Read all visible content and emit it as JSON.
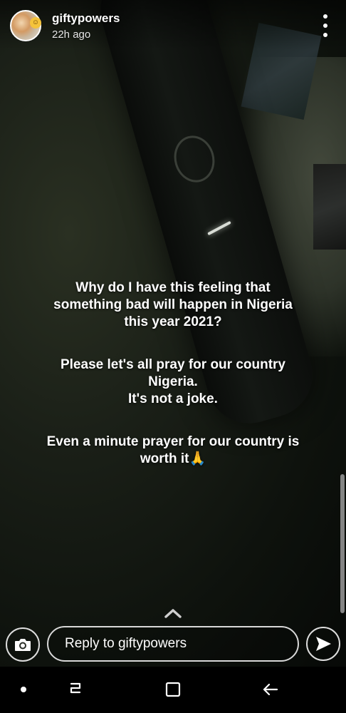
{
  "story": {
    "username": "giftypowers",
    "timestamp": "22h ago",
    "avatar_badge_icon": "smiley-face",
    "caption": {
      "line1": "Why do I have this feeling that",
      "line2": "something bad will happen in Nigeria",
      "line3": "this year 2021?",
      "line4": "Please let's all pray for our country",
      "line5": "Nigeria.",
      "line6": "It's not a joke.",
      "line7": "Even a minute prayer for our country is",
      "line8": "worth it",
      "emoji": "🙏"
    }
  },
  "reply": {
    "placeholder": "Reply to giftypowers",
    "camera_icon": "camera-icon",
    "send_icon": "send-icon"
  },
  "navbar": {
    "items": [
      "nav-dot",
      "recent-apps",
      "home",
      "back"
    ]
  },
  "colors": {
    "text": "#ffffff",
    "nav_bg": "#000000",
    "emoji": "#f2c24a"
  }
}
